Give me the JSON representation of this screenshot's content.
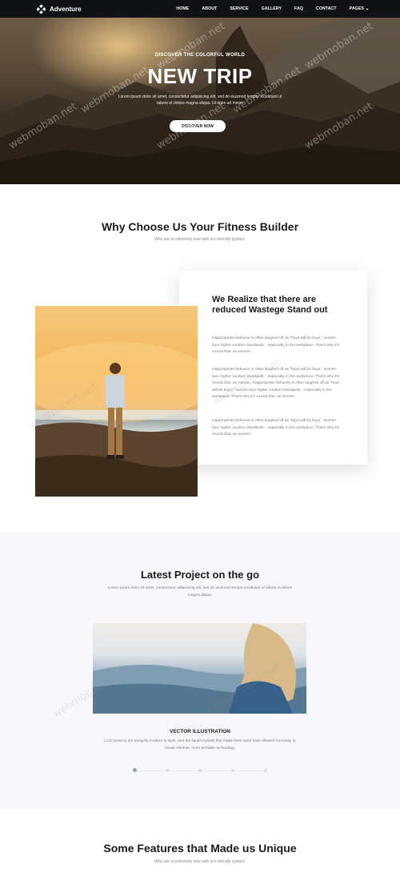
{
  "nav": {
    "brand": "Adventure",
    "items": [
      {
        "label": "HOME"
      },
      {
        "label": "ABOUT"
      },
      {
        "label": "SERVICE"
      },
      {
        "label": "GALLERY"
      },
      {
        "label": "FAQ"
      },
      {
        "label": "CONTACT"
      },
      {
        "label": "PAGES"
      }
    ]
  },
  "hero": {
    "kicker": "DISCOVER THE COLORFUL WORLD",
    "title": "NEW TRIP",
    "text": "Lorem ipsum dolor sit amet, consectetur adipisicing elit, sed do eiusmod tempor incididunt ut labore et dolore magna aliqua. Ut enim ad minim",
    "button": "DISCOVER NOW"
  },
  "why": {
    "title": "Why Choose Us Your Fitness Builder",
    "subtitle": "Who are in extremely love with eco friendly system.",
    "card_title": "We Realize that there are reduced Wastege Stand out",
    "paragraphs": [
      "inappropriate behavior is often laughed off as \"boys will be boys,\" women face higher conduct standards – especially in the workplace. That's why it's crucial that, as women.",
      "inappropriate behavior is often laughed off as \"boys will be boys,\" women face higher conduct standards – especially in the workplace. That's why it's crucial that, as women. inappropriate behavior is often laughed off as \"boys will be boys,\" women face higher conduct standards – especially in the workplace. That's why it's crucial that, as women.",
      "inappropriate behavior is often laughed off as \"boys will be boys,\" women face higher conduct standards – especially in the workplace. That's why it's crucial that, as women."
    ]
  },
  "projects": {
    "title": "Latest Project on the go",
    "text": "Lorem ipsum dolor sit amet, consectetur adipisicing elit, sed do eiusmod tempor incididunt ut labore et dolore magna aliqua.",
    "item_title": "VECTOR ILLUSTRATION",
    "item_text": "LCD screens are uniquely modern in style, and the liquid crystals that make them work have allowed humanity to create slimmer, more portable technology.",
    "slider_count": 5,
    "active_slide": 1
  },
  "features": {
    "title": "Some Features that Made us Unique",
    "subtitle": "Who are in extremely love with eco friendly system."
  },
  "watermark": "webmoban.net",
  "colors": {
    "nav_bg": "#101216",
    "section_alt_bg": "#f8f7fb",
    "accent_dot": "#8aa3a4"
  }
}
